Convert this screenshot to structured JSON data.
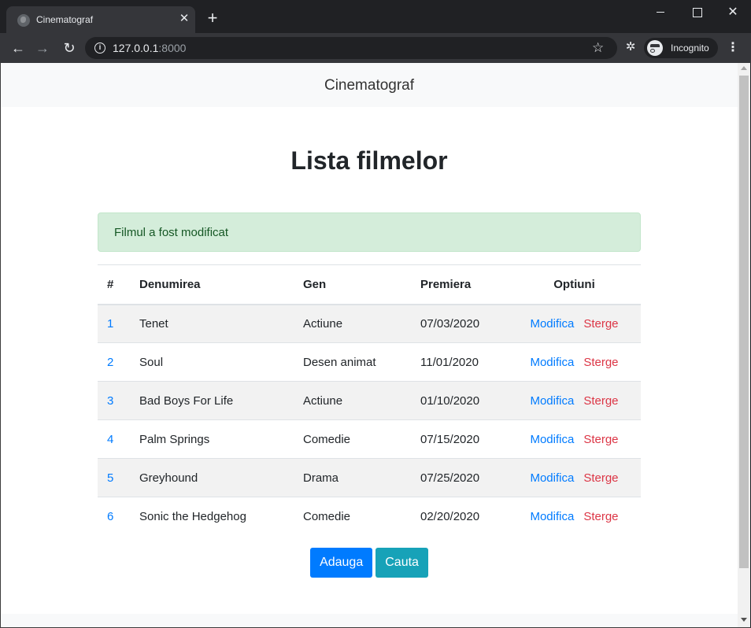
{
  "browser": {
    "tab_title": "Cinematograf",
    "url_host": "127.0.0.1",
    "url_port": ":8000",
    "profile_label": "Incognito",
    "icons": [
      "globe-favicon-icon",
      "close-icon",
      "plus-icon",
      "back-arrow-icon",
      "forward-arrow-icon",
      "reload-icon",
      "info-icon",
      "star-icon",
      "puzzle-icon",
      "incognito-icon",
      "kebab-menu-icon"
    ]
  },
  "navbar": {
    "brand": "Cinematograf"
  },
  "page": {
    "title": "Lista filmelor",
    "alert": "Filmul a fost modificat"
  },
  "table": {
    "headers": {
      "num": "#",
      "name": "Denumirea",
      "genre": "Gen",
      "premiere": "Premiera",
      "options": "Optiuni"
    },
    "rows": [
      {
        "id": "1",
        "name": "Tenet",
        "genre": "Actiune",
        "premiere": "07/03/2020",
        "edit": "Modifica",
        "delete": "Sterge"
      },
      {
        "id": "2",
        "name": "Soul",
        "genre": "Desen animat",
        "premiere": "11/01/2020",
        "edit": "Modifica",
        "delete": "Sterge"
      },
      {
        "id": "3",
        "name": "Bad Boys For Life",
        "genre": "Actiune",
        "premiere": "01/10/2020",
        "edit": "Modifica",
        "delete": "Sterge"
      },
      {
        "id": "4",
        "name": "Palm Springs",
        "genre": "Comedie",
        "premiere": "07/15/2020",
        "edit": "Modifica",
        "delete": "Sterge"
      },
      {
        "id": "5",
        "name": "Greyhound",
        "genre": "Drama",
        "premiere": "07/25/2020",
        "edit": "Modifica",
        "delete": "Sterge"
      },
      {
        "id": "6",
        "name": "Sonic the Hedgehog",
        "genre": "Comedie",
        "premiere": "02/20/2020",
        "edit": "Modifica",
        "delete": "Sterge"
      }
    ]
  },
  "buttons": {
    "add": "Adauga",
    "search": "Cauta"
  },
  "colors": {
    "primary": "#007bff",
    "info": "#17a2b8",
    "danger": "#dc3545",
    "alert_bg": "#d4edda",
    "alert_text": "#155724"
  }
}
